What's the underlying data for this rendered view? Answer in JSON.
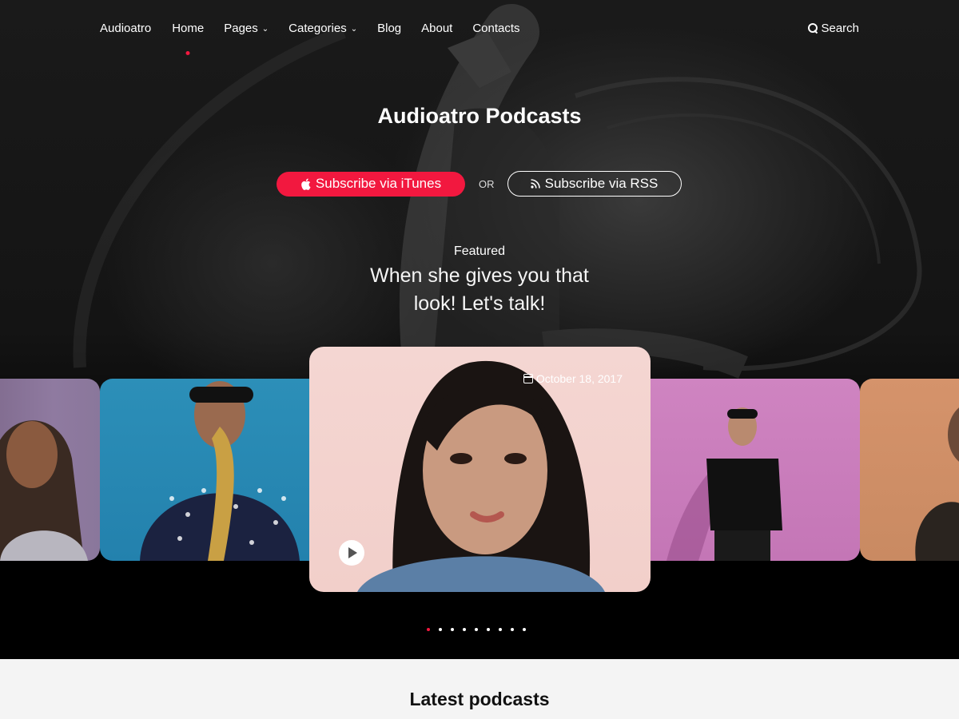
{
  "nav": {
    "logo": "Audioatro",
    "items": [
      {
        "label": "Home",
        "active": true,
        "has_dropdown": false
      },
      {
        "label": "Pages",
        "active": false,
        "has_dropdown": true
      },
      {
        "label": "Categories",
        "active": false,
        "has_dropdown": true
      },
      {
        "label": "Blog",
        "active": false,
        "has_dropdown": false
      },
      {
        "label": "About",
        "active": false,
        "has_dropdown": false
      },
      {
        "label": "Contacts",
        "active": false,
        "has_dropdown": false
      }
    ],
    "search_label": "Search"
  },
  "hero": {
    "title": "Audioatro Podcasts",
    "subscribe_itunes": "Subscribe via iTunes",
    "or_text": "OR",
    "subscribe_rss": "Subscribe via RSS",
    "featured_label": "Featured",
    "featured_title": "When she gives you that look! Let's talk!"
  },
  "carousel": {
    "main_date": "October 18, 2017",
    "dots_total": 9,
    "active_dot": 0
  },
  "latest": {
    "title": "Latest podcasts"
  },
  "colors": {
    "accent": "#f2183f",
    "hero_bg": "#141414",
    "latest_bg": "#f4f4f4"
  }
}
